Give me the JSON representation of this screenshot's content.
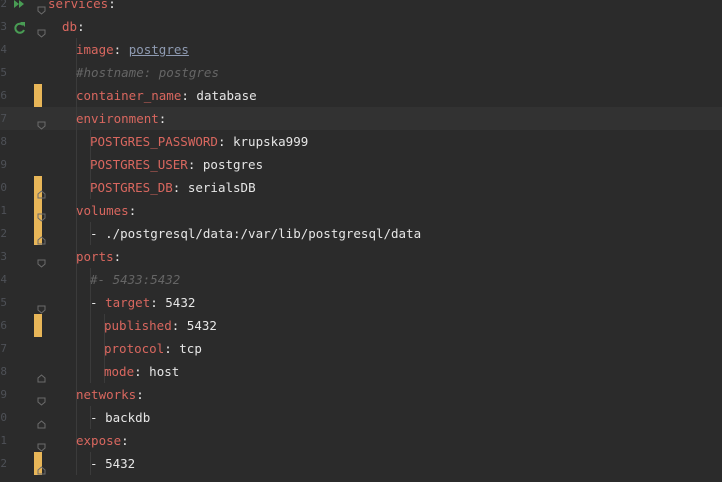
{
  "lines": [
    {
      "num": "2",
      "indent": 0,
      "key": "services",
      "punct": ":",
      "value": "",
      "type": "key",
      "gutter_icon": "run-icon",
      "fold": "open",
      "vcs": false
    },
    {
      "num": "3",
      "indent": 1,
      "key": "db",
      "punct": ":",
      "value": "",
      "type": "key",
      "gutter_icon": "rerun-icon",
      "fold": "open",
      "vcs": false
    },
    {
      "num": "4",
      "indent": 2,
      "key": "image",
      "punct": ": ",
      "value": "postgres",
      "type": "link",
      "gutter_icon": "",
      "fold": "",
      "vcs": false
    },
    {
      "num": "5",
      "indent": 2,
      "key": "",
      "punct": "",
      "value": "#hostname: postgres",
      "type": "comment",
      "gutter_icon": "",
      "fold": "",
      "vcs": false
    },
    {
      "num": "6",
      "indent": 2,
      "key": "container_name",
      "punct": ": ",
      "value": "database",
      "type": "kv",
      "gutter_icon": "",
      "fold": "",
      "vcs": true
    },
    {
      "num": "7",
      "indent": 2,
      "key": "environment",
      "punct": ":",
      "value": "",
      "type": "key",
      "gutter_icon": "",
      "fold": "open",
      "vcs": false
    },
    {
      "num": "8",
      "indent": 3,
      "key": "POSTGRES_PASSWORD",
      "punct": ": ",
      "value": "krupska999",
      "type": "kv",
      "gutter_icon": "",
      "fold": "",
      "vcs": false
    },
    {
      "num": "9",
      "indent": 3,
      "key": "POSTGRES_USER",
      "punct": ": ",
      "value": "postgres",
      "type": "kv",
      "gutter_icon": "",
      "fold": "",
      "vcs": false
    },
    {
      "num": "0",
      "indent": 3,
      "key": "POSTGRES_DB",
      "punct": ": ",
      "value": "serialsDB",
      "type": "kv",
      "gutter_icon": "",
      "fold": "close",
      "vcs": true
    },
    {
      "num": "1",
      "indent": 2,
      "key": "volumes",
      "punct": ":",
      "value": "",
      "type": "key",
      "gutter_icon": "",
      "fold": "open",
      "vcs": true
    },
    {
      "num": "2",
      "indent": 3,
      "key": "",
      "punct": "- ",
      "value": "./postgresql/data:/var/lib/postgresql/data",
      "type": "item",
      "gutter_icon": "",
      "fold": "close",
      "vcs": true
    },
    {
      "num": "3",
      "indent": 2,
      "key": "ports",
      "punct": ":",
      "value": "",
      "type": "key",
      "gutter_icon": "",
      "fold": "open",
      "vcs": false
    },
    {
      "num": "4",
      "indent": 3,
      "key": "",
      "punct": "",
      "value": "#- 5433:5432",
      "type": "comment",
      "gutter_icon": "",
      "fold": "",
      "vcs": false
    },
    {
      "num": "5",
      "indent": 3,
      "key": "target",
      "punct": ": ",
      "value": "5432",
      "type": "itemkv",
      "gutter_icon": "",
      "fold": "open",
      "vcs": false
    },
    {
      "num": "6",
      "indent": 4,
      "key": "published",
      "punct": ": ",
      "value": "5432",
      "type": "kv",
      "gutter_icon": "",
      "fold": "",
      "vcs": true
    },
    {
      "num": "7",
      "indent": 4,
      "key": "protocol",
      "punct": ": ",
      "value": "tcp",
      "type": "kv",
      "gutter_icon": "",
      "fold": "",
      "vcs": false
    },
    {
      "num": "8",
      "indent": 4,
      "key": "mode",
      "punct": ": ",
      "value": "host",
      "type": "kv",
      "gutter_icon": "",
      "fold": "close",
      "vcs": false
    },
    {
      "num": "9",
      "indent": 2,
      "key": "networks",
      "punct": ":",
      "value": "",
      "type": "key",
      "gutter_icon": "",
      "fold": "open",
      "vcs": false
    },
    {
      "num": "0",
      "indent": 3,
      "key": "",
      "punct": "- ",
      "value": "backdb",
      "type": "item",
      "gutter_icon": "",
      "fold": "close",
      "vcs": false
    },
    {
      "num": "1",
      "indent": 2,
      "key": "expose",
      "punct": ":",
      "value": "",
      "type": "key",
      "gutter_icon": "",
      "fold": "open",
      "vcs": false
    },
    {
      "num": "2",
      "indent": 3,
      "key": "",
      "punct": "- ",
      "value": "5432",
      "type": "item",
      "gutter_icon": "",
      "fold": "close",
      "vcs": true
    }
  ],
  "current_line": 5,
  "colors": {
    "background": "#2b2b2b",
    "key": "#cc7832",
    "value": "#e6e6e6",
    "comment": "#656565",
    "vcs_modified": "#e8b658",
    "run_icon": "#499c54"
  }
}
